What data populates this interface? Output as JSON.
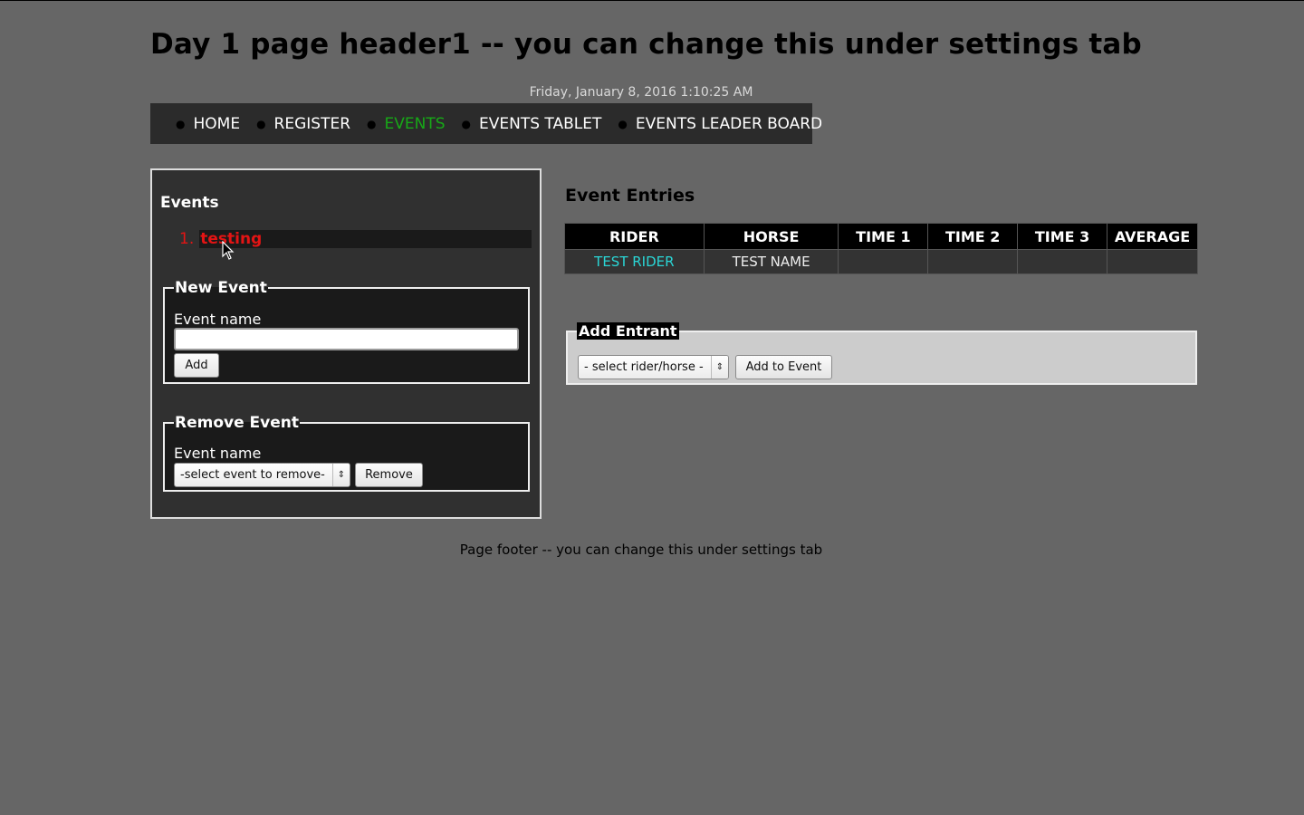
{
  "header": {
    "title": "Day 1 page header1 -- you can change this under settings tab",
    "datetime": "Friday, January 8, 2016 1:10:25 AM"
  },
  "nav": {
    "items": [
      {
        "label": "HOME",
        "active": false
      },
      {
        "label": "REGISTER",
        "active": false
      },
      {
        "label": "EVENTS",
        "active": true
      },
      {
        "label": "EVENTS TABLET",
        "active": false
      },
      {
        "label": "EVENTS LEADER BOARD",
        "active": false
      }
    ]
  },
  "events_panel": {
    "title": "Events",
    "events": [
      {
        "number": "1.",
        "name": "testing"
      }
    ],
    "new_event": {
      "legend": "New Event",
      "field_label": "Event name",
      "input_value": "",
      "add_label": "Add"
    },
    "remove_event": {
      "legend": "Remove Event",
      "field_label": "Event name",
      "select_value": "-select event to remove-",
      "remove_label": "Remove"
    }
  },
  "entries": {
    "title": "Event Entries",
    "columns": [
      "RIDER",
      "HORSE",
      "TIME 1",
      "TIME 2",
      "TIME 3",
      "AVERAGE"
    ],
    "rows": [
      {
        "rider": "TEST RIDER",
        "horse": "TEST NAME",
        "time1": "",
        "time2": "",
        "time3": "",
        "average": ""
      }
    ]
  },
  "add_entrant": {
    "legend": "Add Entrant",
    "select_value": "- select rider/horse -",
    "button_label": "Add to Event"
  },
  "footer": {
    "text": "Page footer -- you can change this under settings tab"
  },
  "colors": {
    "background": "#666666",
    "nav_active": "#17a817",
    "event_name": "#e31414",
    "rider_link": "#2ad6d6"
  }
}
